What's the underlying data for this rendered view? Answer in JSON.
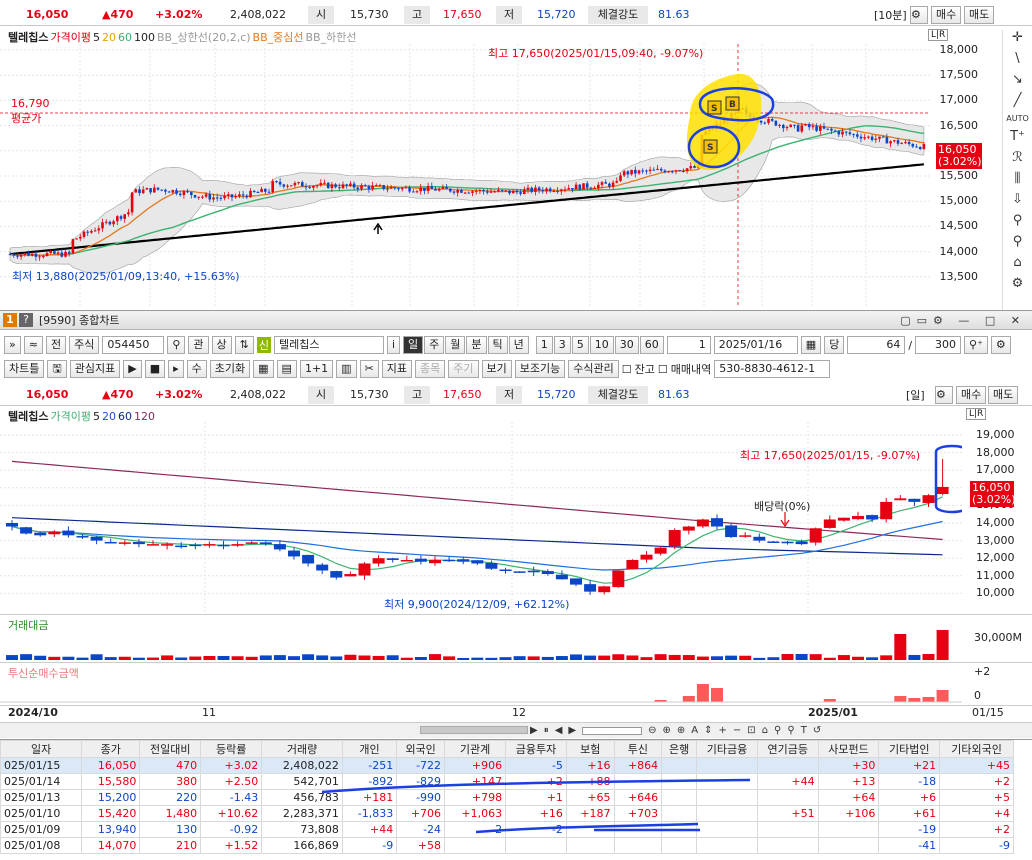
{
  "top_quote": {
    "price": "16,050",
    "change": "▲470",
    "rate": "+3.02%",
    "volume": "2,408,022",
    "open_label": "시",
    "open": "15,730",
    "high_label": "고",
    "high": "17,650",
    "low_label": "저",
    "low": "15,720",
    "strength_label": "체결강도",
    "strength": "81.63",
    "interval": "[10분]",
    "buy": "매수",
    "sell": "매도"
  },
  "top_legend": {
    "name": "텔레칩스",
    "ma_label": "가격이평",
    "ma5": "5",
    "ma20": "20",
    "ma60": "60",
    "ma100": "100",
    "bb_upper": "BB_상한선(20,2,c)",
    "bb_mid": "BB_중심선",
    "bb_lower": "BB_하한선"
  },
  "top_chart": {
    "high_note": "최고 17,650(2025/01/15,09:40, -9.07%)",
    "low_note": "최저 13,880(2025/01/09,13:40, +15.63%)",
    "avg_price": "16,790",
    "avg_label": "평균가",
    "last_price": "16,050",
    "last_rate": "(3.02%)",
    "y_ticks": [
      "18,000",
      "17,500",
      "17,000",
      "16,500",
      "16,000",
      "15,500",
      "15,000",
      "14,500",
      "14,000",
      "13,500"
    ],
    "scale_label": "L|R"
  },
  "top_tools": [
    "✛",
    "\\",
    "↘",
    "╱",
    "AUTO",
    "T⁺",
    "ℛ",
    "⫼",
    "⇩",
    "⚲",
    "⚲",
    "⌂",
    "⚙"
  ],
  "window": {
    "badge": "1",
    "help": "?",
    "title": "[9590] 종합차트"
  },
  "toolbar1": {
    "code": "054450",
    "kwan": "관",
    "sang": "상",
    "new_badge": "신",
    "name": "텔레칩스",
    "i": "i",
    "periods": [
      "일",
      "주",
      "월",
      "분",
      "틱",
      "년"
    ],
    "minutes": [
      "1",
      "3",
      "5",
      "10",
      "30",
      "60"
    ],
    "unit": "1",
    "date": "2025/01/16",
    "count_label": "당",
    "count": "64",
    "slash": "/",
    "total": "300",
    "jeon": "전",
    "jusik": "주식"
  },
  "toolbar2": {
    "items": [
      "차트틀",
      "관심지표",
      "수",
      "초기화",
      "지표",
      "종목",
      "주기",
      "보기",
      "보조기능",
      "수식관리"
    ],
    "jango": "잔고",
    "trades": "매매내역",
    "account": "530-8830-4612-1"
  },
  "bottom_quote": {
    "price": "16,050",
    "change": "▲470",
    "rate": "+3.02%",
    "volume": "2,408,022",
    "open_label": "시",
    "open": "15,730",
    "high_label": "고",
    "high": "17,650",
    "low_label": "저",
    "low": "15,720",
    "strength_label": "체결강도",
    "strength": "81.63",
    "interval": "[일]",
    "buy": "매수",
    "sell": "매도"
  },
  "bottom_legend": {
    "name": "텔레칩스",
    "ma_label": "가격이평",
    "ma5": "5",
    "ma20": "20",
    "ma60": "60",
    "ma120": "120"
  },
  "daily_chart": {
    "high_note": "최고 17,650(2025/01/15, -9.07%)",
    "low_note": "최저 9,900(2024/12/09, +62.12%)",
    "dividend": "배당락(0%)",
    "last_price": "16,050",
    "last_rate": "(3.02%)",
    "y_ticks": [
      "19,000",
      "18,000",
      "17,000",
      "16,000",
      "15,000",
      "14,000",
      "13,000",
      "12,000",
      "11,000",
      "10,000"
    ],
    "scale_label": "L|R"
  },
  "volume_panel": {
    "title": "거래대금",
    "tick": "30,000M"
  },
  "trust_panel": {
    "title": "투신순매수금액",
    "tick1": "+2",
    "tick0": "0"
  },
  "x_axis": {
    "labels": [
      "2024/10",
      "11",
      "12",
      "2025/01",
      "01/15"
    ]
  },
  "colors": {
    "up": "#e60012",
    "down": "#0b46c8",
    "ma5": "#e6781e",
    "ma20": "#3cb371",
    "ma60": "#000000",
    "ma120": "#8b2a5a",
    "annot": "#1b3fe0",
    "hl": "#ffe000"
  },
  "table": {
    "headers": [
      "일자",
      "종가",
      "전일대비",
      "등락률",
      "거래량",
      "개인",
      "외국인",
      "기관계",
      "금융투자",
      "보험",
      "투신",
      "은행",
      "기타금융",
      "연기금등",
      "사모펀드",
      "기타법인",
      "기타외국인"
    ],
    "rows": [
      [
        "025/01/15",
        "16,050",
        "470",
        "+3.02",
        "2,408,022",
        "-251",
        "-722",
        "+906",
        "-5",
        "+16",
        "+864",
        "",
        "",
        "",
        "+30",
        "+21",
        "+45"
      ],
      [
        "025/01/14",
        "15,580",
        "380",
        "+2.50",
        "542,701",
        "-892",
        "-829",
        "+147",
        "+2",
        "+88",
        "",
        "",
        "",
        "+44",
        "+13",
        "-18",
        "+2"
      ],
      [
        "025/01/13",
        "15,200",
        "220",
        "-1.43",
        "456,783",
        "+181",
        "-990",
        "+798",
        "+1",
        "+65",
        "+646",
        "",
        "",
        "",
        "+64",
        "+6",
        "+5"
      ],
      [
        "025/01/10",
        "15,420",
        "1,480",
        "+10.62",
        "2,283,371",
        "-1,833",
        "+706",
        "+1,063",
        "+16",
        "+187",
        "+703",
        "",
        "",
        "+51",
        "+106",
        "+61",
        "+4"
      ],
      [
        "025/01/09",
        "13,940",
        "130",
        "-0.92",
        "73,808",
        "+44",
        "-24",
        "-2",
        "-2",
        "",
        "",
        "",
        "",
        "",
        "",
        "-19",
        "+2"
      ],
      [
        "025/01/08",
        "14,070",
        "210",
        "+1.52",
        "166,869",
        "-9",
        "+58",
        "",
        "",
        "",
        "",
        "",
        "",
        "",
        "",
        "-41",
        "-9"
      ]
    ]
  }
}
